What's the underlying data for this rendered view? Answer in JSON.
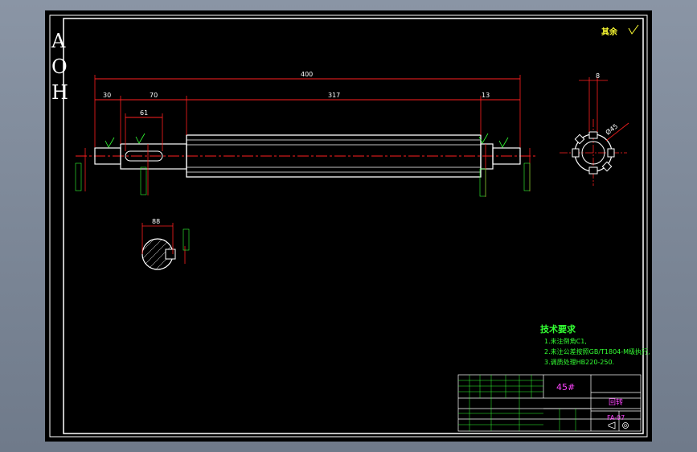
{
  "drawing": {
    "side_code": [
      "A",
      "O",
      "H"
    ],
    "surface_note": "其余",
    "dimensions": {
      "overall_length": "400",
      "seg1": "30",
      "seg2": "70",
      "seg3": "317",
      "seg4": "13",
      "key_len": "61",
      "tail": "8",
      "section_width": "88",
      "circle_dia": "Ø45"
    },
    "tech_req": {
      "title": "技术要求",
      "lines": [
        "1.未注倒角C1,",
        "2.未注公差按照GB/T1804-M级执行,",
        "3.调质处理HB220-250."
      ]
    },
    "title_block": {
      "material": "45#",
      "part_name": "回转",
      "drawing_no": "FA-07"
    }
  },
  "colors": {
    "sheet_bg": "#000000",
    "frame": "#ffffff",
    "dimension": "#ff2020",
    "center_line": "#ff2020",
    "text_green": "#33ff33",
    "text_yellow": "#ffff33",
    "text_magenta": "#ff44ff"
  }
}
